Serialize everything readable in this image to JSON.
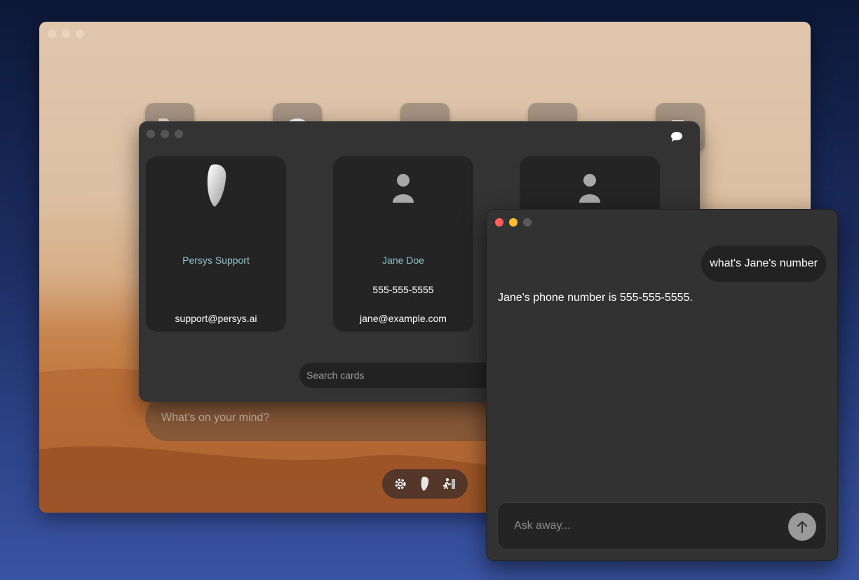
{
  "desktop": {
    "mind_placeholder": "What's on your mind?",
    "dock_icons": [
      "folder-icon",
      "chat-bubble-icon",
      "contact-card-icon",
      "keyboard-icon",
      "document-icon"
    ],
    "toolbar_icons": [
      "gear-icon",
      "persys-logo-icon",
      "exit-icon"
    ]
  },
  "cards_window": {
    "cards": [
      {
        "name": "Persys Support",
        "phone": "",
        "email": "support@persys.ai",
        "avatar": "persys-logo-icon"
      },
      {
        "name": "Jane Doe",
        "phone": "555-555-5555",
        "email": "jane@example.com",
        "avatar": "person-icon"
      },
      {
        "name": "",
        "phone": "",
        "email": "",
        "avatar": "person-icon"
      }
    ],
    "search_placeholder": "Search cards"
  },
  "chat_window": {
    "user_message": "what's Jane's number",
    "assistant_message": "Jane's phone number is 555-555-5555.",
    "input_placeholder": "Ask away..."
  },
  "colors": {
    "card_name": "#8dc4c8",
    "window_bg": "#333333",
    "card_bg": "#242424",
    "close": "#ff5f57",
    "minimize": "#febc2e"
  }
}
